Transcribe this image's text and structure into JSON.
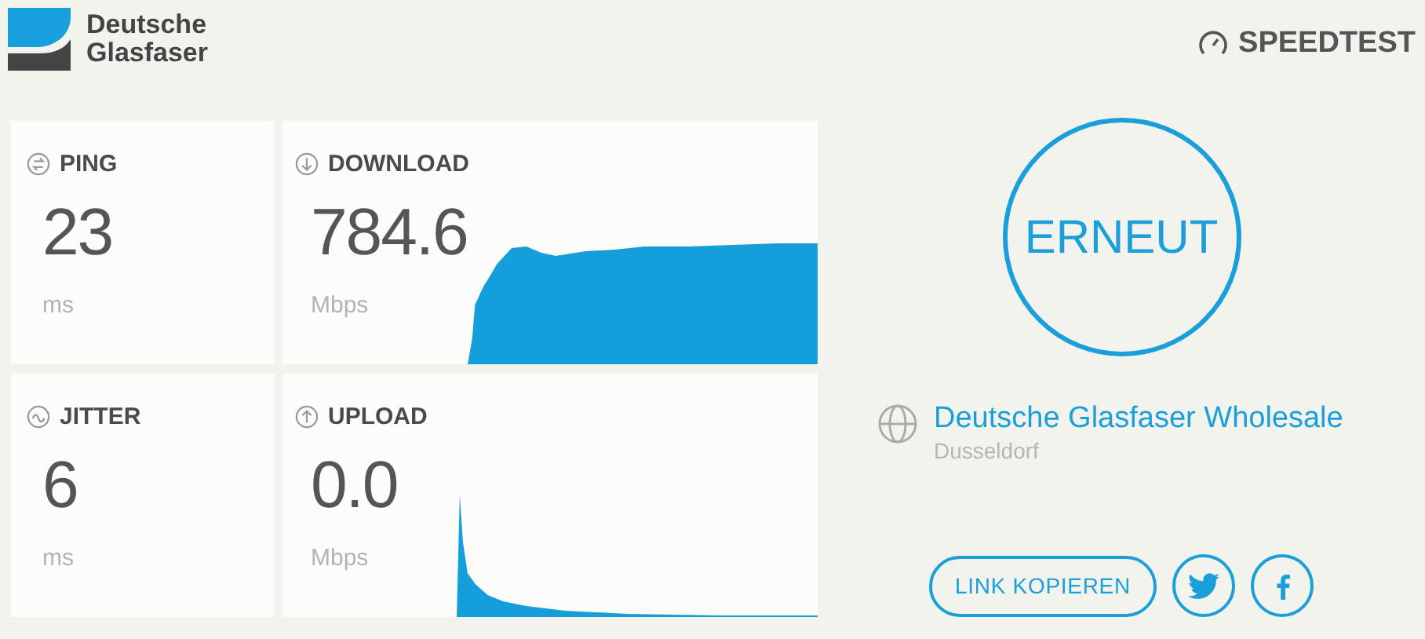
{
  "brand": {
    "line1": "Deutsche",
    "line2": "Glasfaser"
  },
  "speedtest_logo": "SPEEDTEST",
  "metrics": [
    {
      "kind": "ping",
      "label": "PING",
      "value": "23",
      "unit": "ms"
    },
    {
      "kind": "download",
      "label": "DOWNLOAD",
      "value": "784.6",
      "unit": "Mbps"
    },
    {
      "kind": "jitter",
      "label": "JITTER",
      "value": "6",
      "unit": "ms"
    },
    {
      "kind": "upload",
      "label": "UPLOAD",
      "value": "0.0",
      "unit": "Mbps"
    }
  ],
  "again_button": "ERNEUT",
  "provider": {
    "name": "Deutsche Glasfaser Wholesale",
    "location": "Dusseldorf"
  },
  "share": {
    "copy_link": "LINK KOPIEREN"
  }
}
